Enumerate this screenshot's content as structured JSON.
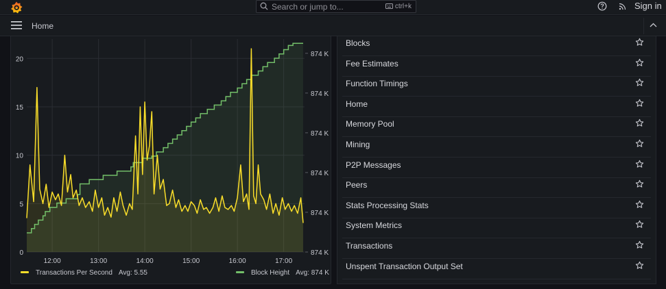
{
  "topbar": {
    "logo_icon": "grafana-logo-icon",
    "search_placeholder": "Search or jump to...",
    "search_shortcut": "ctrl+k",
    "sign_in": "Sign in",
    "help_icon": "help-circle-icon",
    "news_icon": "rss-icon"
  },
  "navbar": {
    "breadcrumb": "Home",
    "menu_icon": "hamburger-menu-icon",
    "collapse_icon": "chevron-up-icon"
  },
  "dashboard_list": [
    {
      "label": "Blocks"
    },
    {
      "label": "Fee Estimates"
    },
    {
      "label": "Function Timings"
    },
    {
      "label": "Home"
    },
    {
      "label": "Memory Pool"
    },
    {
      "label": "Mining"
    },
    {
      "label": "P2P Messages"
    },
    {
      "label": "Peers"
    },
    {
      "label": "Stats Processing Stats"
    },
    {
      "label": "System Metrics"
    },
    {
      "label": "Transactions"
    },
    {
      "label": "Unspent Transaction Output Set"
    }
  ],
  "colors": {
    "tps": "#fade2a",
    "block_height": "#73bf69",
    "background": "#111217",
    "panel": "#181b1f"
  },
  "chart_data": {
    "type": "line",
    "x_ticks": [
      "12:00",
      "13:00",
      "14:00",
      "15:00",
      "16:00",
      "17:00"
    ],
    "y_left_ticks": [
      "0",
      "5",
      "10",
      "15",
      "20"
    ],
    "y_left_range": [
      0,
      22
    ],
    "y_right_ticks": [
      "874 K",
      "874 K",
      "874 K",
      "874 K",
      "874 K",
      "874 K"
    ],
    "grid": true,
    "legend_placement": "bottom",
    "series": [
      {
        "name": "Transactions Per Second",
        "axis": "left",
        "avg_label": "Avg: 5.55",
        "t": [
          11.45,
          11.52,
          11.6,
          11.67,
          11.73,
          11.8,
          11.87,
          11.93,
          12.0,
          12.07,
          12.13,
          12.2,
          12.27,
          12.33,
          12.4,
          12.45,
          12.52,
          12.58,
          12.65,
          12.72,
          12.8,
          12.87,
          12.93,
          13.0,
          13.07,
          13.13,
          13.2,
          13.27,
          13.33,
          13.4,
          13.47,
          13.53,
          13.6,
          13.67,
          13.73,
          13.8,
          13.85,
          13.9,
          13.95,
          14.0,
          14.05,
          14.1,
          14.15,
          14.2,
          14.27,
          14.33,
          14.4,
          14.47,
          14.53,
          14.6,
          14.67,
          14.73,
          14.8,
          14.87,
          14.93,
          15.0,
          15.07,
          15.13,
          15.2,
          15.27,
          15.33,
          15.4,
          15.47,
          15.53,
          15.6,
          15.67,
          15.73,
          15.8,
          15.87,
          15.93,
          16.0,
          16.07,
          16.13,
          16.2,
          16.25,
          16.3,
          16.35,
          16.4,
          16.45,
          16.5,
          16.57,
          16.63,
          16.7,
          16.77,
          16.83,
          16.9,
          16.97,
          17.03,
          17.1,
          17.17,
          17.23,
          17.3,
          17.37,
          17.42
        ],
        "values": [
          3.5,
          9.0,
          5.2,
          17.0,
          6.5,
          5.0,
          7.0,
          4.6,
          6.2,
          5.4,
          6.0,
          4.8,
          10.0,
          6.2,
          8.0,
          5.6,
          6.4,
          4.8,
          5.6,
          4.6,
          5.2,
          4.2,
          6.4,
          4.6,
          5.6,
          3.8,
          4.6,
          3.6,
          5.6,
          4.2,
          6.2,
          4.8,
          3.8,
          5.0,
          4.4,
          12.0,
          6.0,
          15.0,
          8.0,
          15.5,
          9.5,
          11.0,
          14.5,
          6.0,
          10.0,
          6.5,
          7.5,
          4.8,
          5.0,
          6.4,
          4.6,
          5.4,
          4.2,
          4.8,
          4.2,
          5.2,
          4.8,
          4.0,
          5.4,
          4.4,
          4.6,
          4.0,
          4.6,
          5.6,
          4.2,
          5.8,
          4.6,
          4.4,
          4.8,
          4.2,
          5.6,
          9.0,
          5.2,
          6.0,
          4.4,
          21.0,
          5.8,
          5.0,
          9.0,
          6.0,
          5.4,
          4.4,
          6.0,
          4.0,
          5.0,
          3.8,
          5.6,
          4.4,
          5.0,
          4.2,
          4.8,
          4.0,
          5.6,
          3.0
        ]
      },
      {
        "name": "Block Height",
        "axis": "right",
        "avg_label": "Avg: 874 K",
        "t": [
          11.45,
          11.55,
          11.62,
          11.7,
          11.8,
          11.85,
          11.95,
          12.1,
          12.3,
          12.55,
          12.6,
          12.8,
          13.1,
          13.4,
          13.7,
          13.75,
          13.95,
          14.15,
          14.25,
          14.4,
          14.5,
          14.6,
          14.7,
          14.8,
          14.9,
          15.0,
          15.1,
          15.2,
          15.35,
          15.5,
          15.65,
          15.75,
          15.85,
          16.0,
          16.1,
          16.2,
          16.3,
          16.45,
          16.55,
          16.65,
          16.8,
          16.9,
          17.0,
          17.1,
          17.2,
          17.42
        ],
        "values": [
          0.09,
          0.11,
          0.13,
          0.15,
          0.17,
          0.19,
          0.21,
          0.23,
          0.25,
          0.27,
          0.32,
          0.34,
          0.36,
          0.38,
          0.4,
          0.42,
          0.44,
          0.45,
          0.47,
          0.49,
          0.51,
          0.53,
          0.55,
          0.57,
          0.59,
          0.61,
          0.63,
          0.65,
          0.67,
          0.69,
          0.71,
          0.73,
          0.75,
          0.77,
          0.79,
          0.81,
          0.83,
          0.85,
          0.87,
          0.89,
          0.91,
          0.93,
          0.95,
          0.97,
          0.98,
          0.98
        ]
      }
    ]
  }
}
